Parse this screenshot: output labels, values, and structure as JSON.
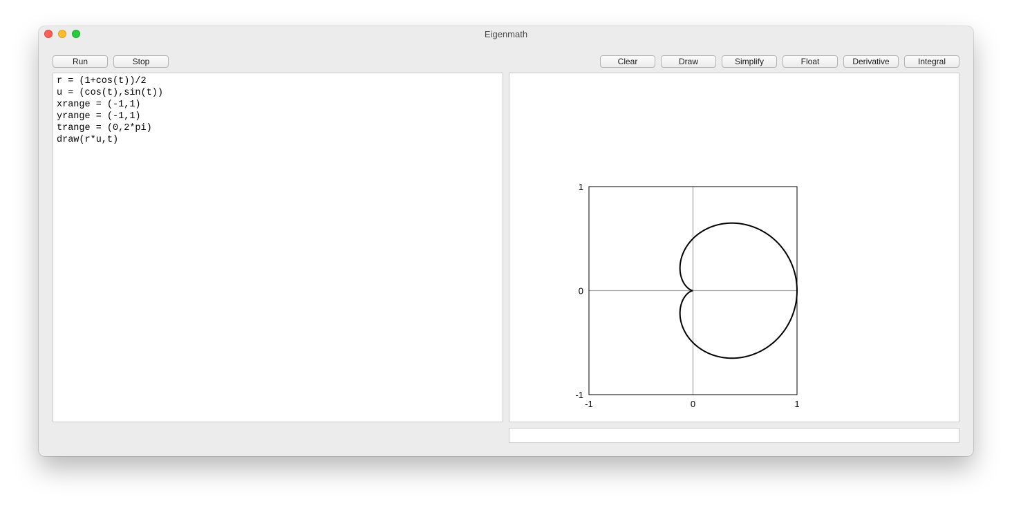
{
  "window": {
    "title": "Eigenmath"
  },
  "toolbar": {
    "run_label": "Run",
    "stop_label": "Stop",
    "clear_label": "Clear",
    "draw_label": "Draw",
    "simplify_label": "Simplify",
    "float_label": "Float",
    "derivative_label": "Derivative",
    "integral_label": "Integral"
  },
  "editor": {
    "lines": [
      "r = (1+cos(t))/2",
      "u = (cos(t),sin(t))",
      "xrange = (-1,1)",
      "yrange = (-1,1)",
      "trange = (0,2*pi)",
      "draw(r*u,t)"
    ]
  },
  "status": {
    "text": ""
  },
  "colors": {
    "curve": "#000000",
    "axis": "#a0a0a0",
    "frame": "#000000"
  },
  "chart_data": {
    "type": "line",
    "curve": "parametric: x = r*cos(t), y = r*sin(t), r = (1+cos(t))/2",
    "xlim": [
      -1,
      1
    ],
    "ylim": [
      -1,
      1
    ],
    "trange": [
      0,
      6.283185307
    ],
    "x_tick_labels": [
      "-1",
      "0",
      "1"
    ],
    "y_tick_labels": [
      "1",
      "0",
      "-1"
    ],
    "grid": false,
    "points": [
      [
        1.0,
        0.0
      ],
      [
        0.976,
        0.2
      ],
      [
        0.908,
        0.383
      ],
      [
        0.8,
        0.538
      ],
      [
        0.662,
        0.644
      ],
      [
        0.505,
        0.688
      ],
      [
        0.341,
        0.665
      ],
      [
        0.182,
        0.578
      ],
      [
        0.037,
        0.434
      ],
      [
        -0.083,
        0.249
      ],
      [
        -0.168,
        0.05
      ],
      [
        -0.215,
        -0.139
      ],
      [
        -0.224,
        -0.293
      ],
      [
        -0.199,
        -0.389
      ],
      [
        -0.148,
        -0.419
      ],
      [
        -0.082,
        -0.384
      ],
      [
        -0.016,
        -0.295
      ],
      [
        0.036,
        -0.174
      ],
      [
        0.0,
        0.0
      ]
    ],
    "sample_count": 360
  }
}
